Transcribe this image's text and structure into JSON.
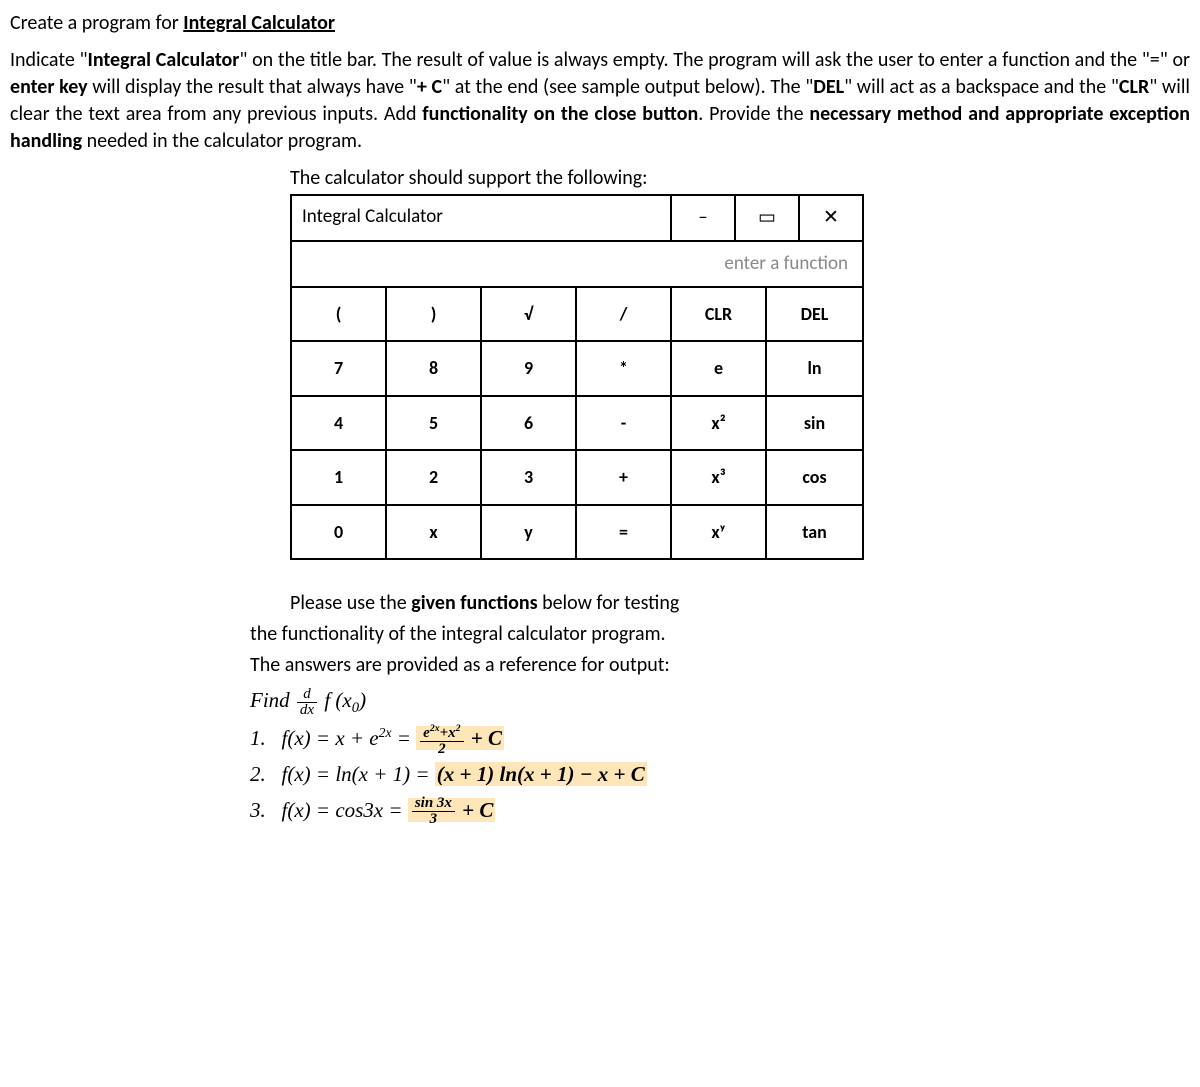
{
  "heading_pre": "Create a program for ",
  "heading_u": "Integral Calculator",
  "paragraph": {
    "p1a": "Indicate \"",
    "p1b": "Integral Calculator",
    "p1c": "\" on the title bar. The result of value is always empty. The program will ask the user to enter a function and the \"=\" or ",
    "p1d": "enter key",
    "p1e": " will display the result that always have \"",
    "p1f": "+ C",
    "p1g": "\" at the end (see sample output below). The \"",
    "p1h": "DEL",
    "p1i": "\" will act as a backspace and the \"",
    "p1j": "CLR",
    "p1k": "\" will clear the text area from any previous inputs. Add ",
    "p1l": "functionality on the close button",
    "p1m": ". Provide the ",
    "p1n": "necessary method and appropriate exception handling",
    "p1o": " needed in the calculator program."
  },
  "calc_caption": "The calculator should support the following:",
  "window": {
    "title": "Integral Calculator",
    "min": "–",
    "max": "▭",
    "close": "✕",
    "placeholder": "enter a function"
  },
  "keys": [
    "(",
    ")",
    "√",
    "/",
    "CLR",
    "DEL",
    "7",
    "8",
    "9",
    "*",
    "e",
    "ln",
    "4",
    "5",
    "6",
    "-",
    "x²",
    "sin",
    "1",
    "2",
    "3",
    "+",
    "x³",
    "cos",
    "0",
    "x",
    "y",
    "=",
    "xʸ",
    "tan"
  ],
  "keynames": [
    "lparen",
    "rparen",
    "sqrt",
    "divide",
    "clr",
    "del",
    "seven",
    "eight",
    "nine",
    "multiply",
    "e",
    "ln",
    "four",
    "five",
    "six",
    "minus",
    "xsquared",
    "sin",
    "one",
    "two",
    "three",
    "plus",
    "xcubed",
    "cos",
    "zero",
    "x",
    "y",
    "equals",
    "xpowy",
    "tan"
  ],
  "test": {
    "intro1a": "Please use the ",
    "intro1b": "given functions",
    "intro1c": " below for testing",
    "intro2": "the functionality of the integral calculator program.",
    "intro3": "The answers are provided as a reference for output:"
  }
}
